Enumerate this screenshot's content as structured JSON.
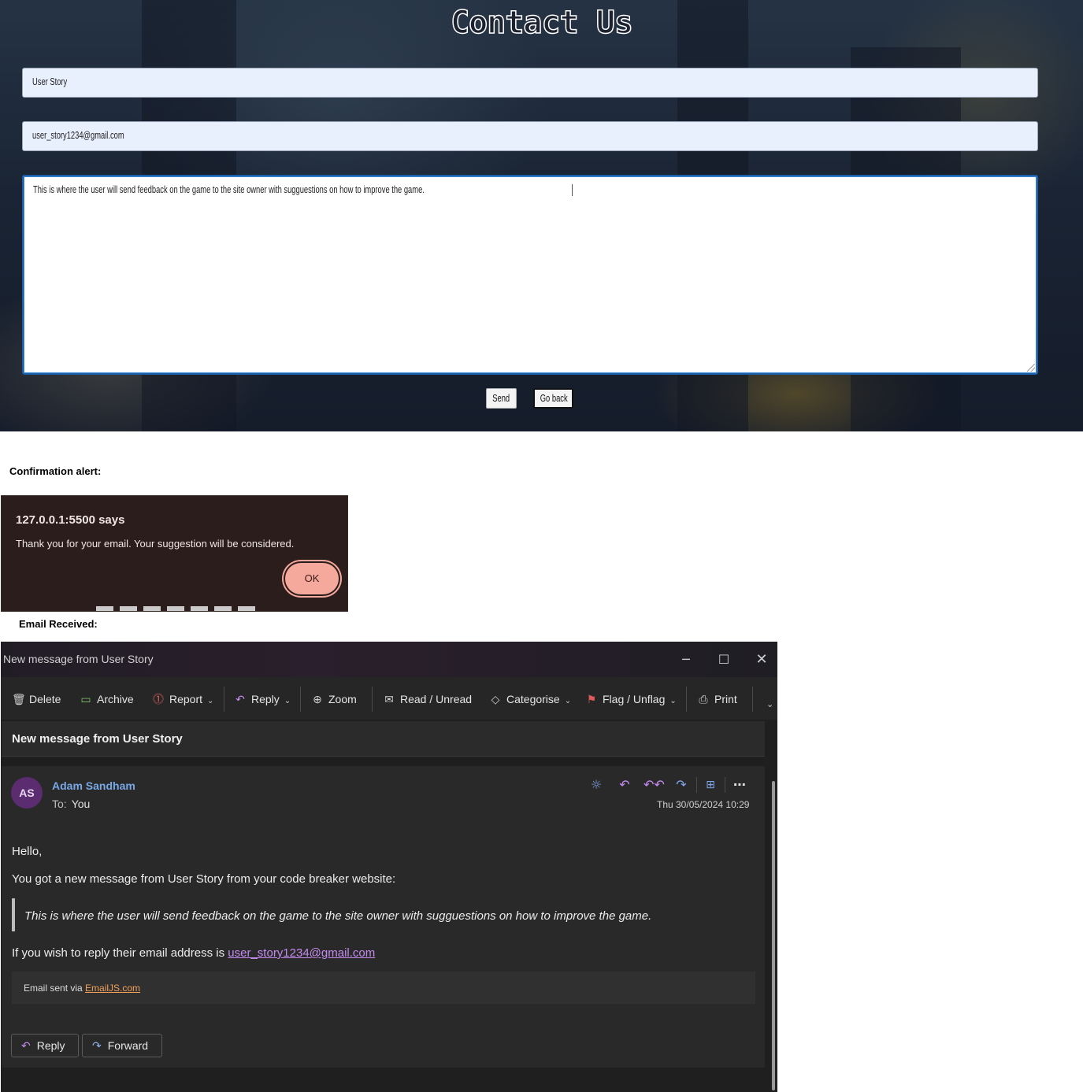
{
  "contact_page": {
    "title": "Contact Us",
    "name_value": "User Story",
    "email_value": "user_story1234@gmail.com",
    "message_value": "This is where the user will send feedback on the game to the site owner with sugguestions on how to improve the game.",
    "send_label": "Send",
    "go_back_label": "Go back"
  },
  "labels": {
    "confirmation": "Confirmation alert:",
    "email_received": "Email Received:"
  },
  "alert": {
    "origin": "127.0.0.1:5500 says",
    "message": "Thank you for your email. Your suggestion will be considered.",
    "ok_label": "OK",
    "colors": {
      "background": "#2a1d1c",
      "button": "#f5a89c"
    }
  },
  "mail_window": {
    "title": "New message from User Story",
    "controls": {
      "minimize": "─",
      "maximize": "☐",
      "close": "✕"
    },
    "ribbon": [
      {
        "label": "Delete",
        "icon": "trash-icon",
        "glyph": "🗑"
      },
      {
        "label": "Archive",
        "icon": "archive-icon",
        "glyph": "▭"
      },
      {
        "label": "Report",
        "icon": "report-icon",
        "glyph": "!"
      },
      {
        "label": "Reply",
        "icon": "reply-icon",
        "glyph": "↶"
      },
      {
        "label": "Zoom",
        "icon": "zoom-icon",
        "glyph": "⊕"
      },
      {
        "label": "Read / Unread",
        "icon": "envelope-icon",
        "glyph": "✉"
      },
      {
        "label": "Categorise",
        "icon": "tag-icon",
        "glyph": "◇"
      },
      {
        "label": "Flag / Unflag",
        "icon": "flag-icon",
        "glyph": "⚑"
      },
      {
        "label": "Print",
        "icon": "printer-icon",
        "glyph": "⎙"
      }
    ],
    "subject": "New message from User Story",
    "sender": {
      "initials": "AS",
      "name": "Adam Sandham",
      "to_label": "To:",
      "to_value": "You"
    },
    "date": "Thu 30/05/2024 10:29",
    "body": {
      "greeting": "Hello,",
      "intro": "You got a new message from User Story from your code breaker website:",
      "quote": "This is where the user will send feedback on the game to the site owner with sugguestions on how to improve the game.",
      "reply_prefix": "If you wish to reply their email address is ",
      "reply_email": "user_story1234@gmail.com",
      "footer_prefix": "Email sent via ",
      "footer_link": "EmailJS.com"
    },
    "bottom_buttons": {
      "reply": "Reply",
      "forward": "Forward"
    },
    "colors": {
      "accent_link": "#79a8e6",
      "reply_link": "#c58af0",
      "footer_link": "#f2a05a",
      "avatar": "#5b2c6f"
    }
  }
}
